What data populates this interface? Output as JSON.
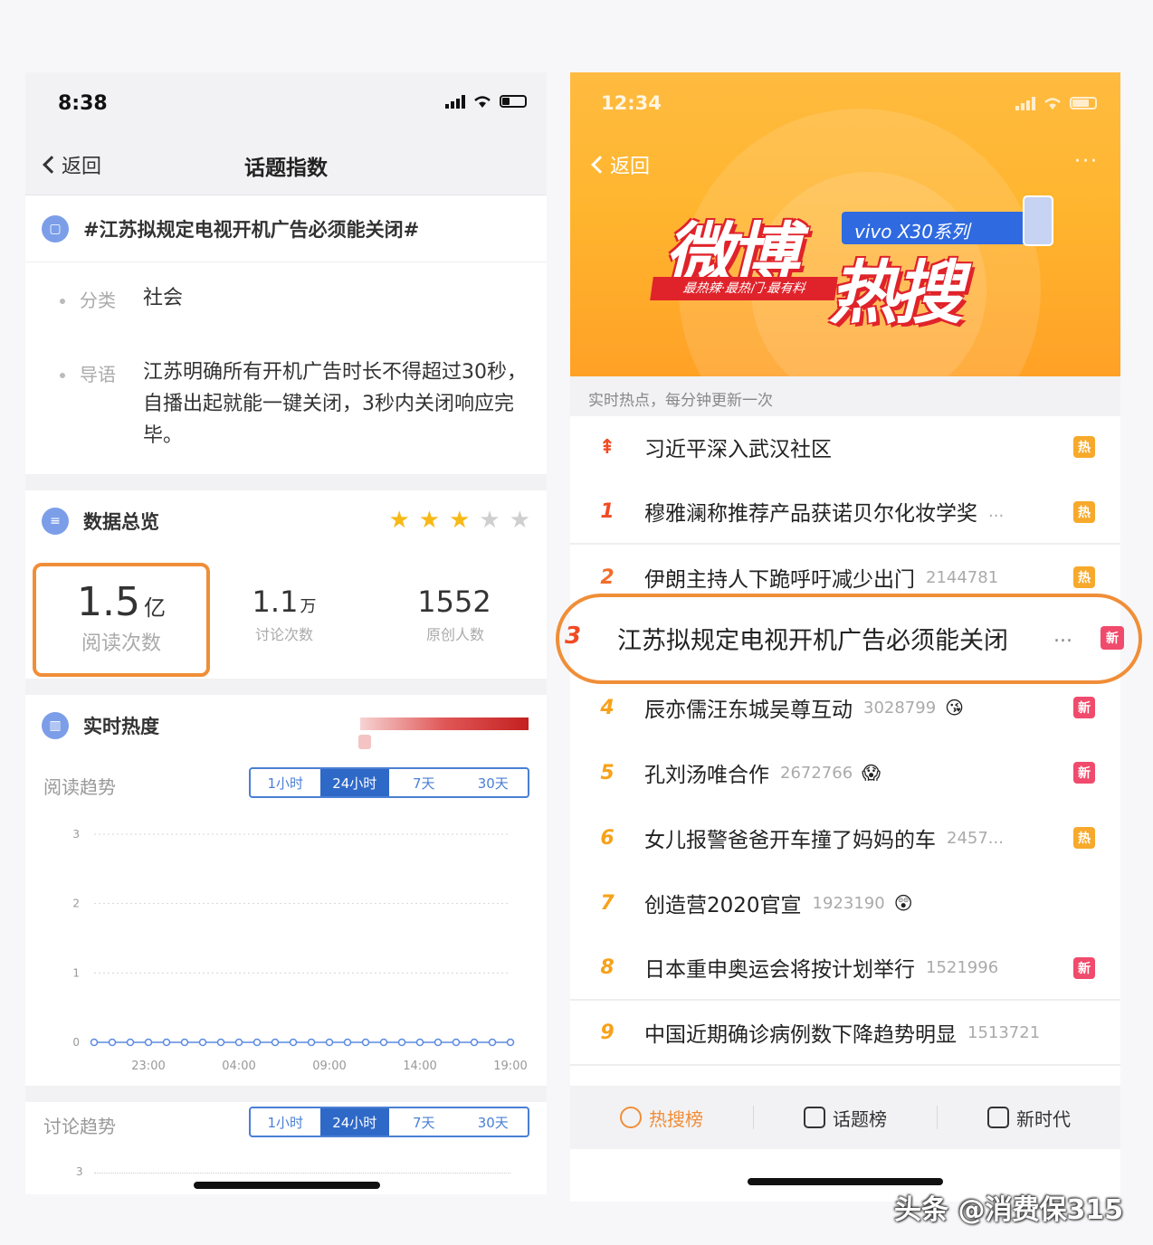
{
  "left": {
    "status_time": "8:38",
    "nav": {
      "back": "返回",
      "title": "话题指数"
    },
    "topic": {
      "icon": "topic-icon",
      "title": "#江苏拟规定电视开机广告必须能关闭#"
    },
    "info": [
      {
        "key": "分类",
        "value": "社会"
      },
      {
        "key": "导语",
        "value": "江苏明确所有开机广告时长不得超过30秒，自播出起就能一键关闭，3秒内关闭响应完毕。"
      }
    ],
    "overview": {
      "title": "数据总览",
      "rating": 3,
      "max_rating": 5,
      "stats": [
        {
          "num": "1.5",
          "unit": "亿",
          "label": "阅读次数"
        },
        {
          "num": "1.1",
          "unit": "万",
          "label": "讨论次数"
        },
        {
          "num": "1552",
          "unit": "",
          "label": "原创人数"
        }
      ]
    },
    "realtime": {
      "title": "实时热度",
      "read_trend": "阅读趋势",
      "discuss_trend": "讨论趋势",
      "tabs": [
        "1小时",
        "24小时",
        "7天",
        "30天"
      ],
      "active_tab": "24小时",
      "discuss_y_first": "3"
    }
  },
  "right": {
    "status_time": "12:34",
    "nav": {
      "back": "返回",
      "more": "···"
    },
    "banner": {
      "logo_part1": "微博",
      "logo_part2": "热搜",
      "sponsor": "vivo X30系列",
      "slogan": "最热辣·最热门·最有料"
    },
    "subtitle": "实时热点，每分钟更新一次",
    "items": [
      {
        "rank": "",
        "rank_icon": "pin-icon",
        "text": "习近平深入武汉社区",
        "num": "",
        "ellipsis": "",
        "emoji": "",
        "badge": "热"
      },
      {
        "rank": "1",
        "text": "穆雅澜称推荐产品获诺贝尔化妆学奖",
        "num": "",
        "ellipsis": "...",
        "emoji": "",
        "badge": "热"
      },
      {
        "rank": "2",
        "text": "伊朗主持人下跪呼吁减少出门",
        "num": "2144781",
        "ellipsis": "",
        "emoji": "",
        "badge": "热"
      },
      {
        "rank": "3",
        "text": "江苏拟规定电视开机广告必须能关闭",
        "num": "",
        "ellipsis": "...",
        "emoji": "",
        "badge": "新"
      },
      {
        "rank": "4",
        "text": "辰亦儒汪东城吴尊互动",
        "num": "3028799",
        "ellipsis": "",
        "emoji": "😘",
        "badge": "新"
      },
      {
        "rank": "5",
        "text": "孔刘汤唯合作",
        "num": "2672766",
        "ellipsis": "",
        "emoji": "😱",
        "badge": "新"
      },
      {
        "rank": "6",
        "text": "女儿报警爸爸开车撞了妈妈的车",
        "num": "2457...",
        "ellipsis": "",
        "emoji": "",
        "badge": "热"
      },
      {
        "rank": "7",
        "text": "创造营2020官宣",
        "num": "1923190",
        "ellipsis": "",
        "emoji": "😲",
        "badge": ""
      },
      {
        "rank": "8",
        "text": "日本重申奥运会将按计划举行",
        "num": "1521996",
        "ellipsis": "",
        "emoji": "",
        "badge": "新"
      },
      {
        "rank": "9",
        "text": "中国近期确诊病例数下降趋势明显",
        "num": "1513721",
        "ellipsis": "",
        "emoji": "",
        "badge": ""
      }
    ],
    "bottom_tabs": [
      {
        "label": "热搜榜",
        "icon": "hot-search-icon",
        "active": true
      },
      {
        "label": "话题榜",
        "icon": "topic-list-icon",
        "active": false
      },
      {
        "label": "新时代",
        "icon": "new-era-icon",
        "active": false
      }
    ]
  },
  "watermark": "头条 @消费保315",
  "chart_data": {
    "type": "line",
    "title": "阅读趋势",
    "xlabel": "",
    "ylabel": "",
    "x_ticks": [
      "23:00",
      "04:00",
      "09:00",
      "14:00",
      "19:00"
    ],
    "y_ticks": [
      0,
      1,
      2,
      3
    ],
    "ylim": [
      0,
      3
    ],
    "grid": true,
    "series": [
      {
        "values": [
          0,
          0,
          0,
          0,
          0,
          0,
          0,
          0,
          0,
          0,
          0,
          0,
          0,
          0,
          0,
          0,
          0,
          0,
          0,
          0,
          0,
          0,
          0,
          0
        ]
      }
    ]
  },
  "colors": {
    "highlight": "#f08e38",
    "tab_active": "#2f69c8",
    "badge_hot": "#f7a92b",
    "badge_new": "#f04b6c",
    "star_on": "#f6b917",
    "star_off": "#cfcfcf"
  }
}
